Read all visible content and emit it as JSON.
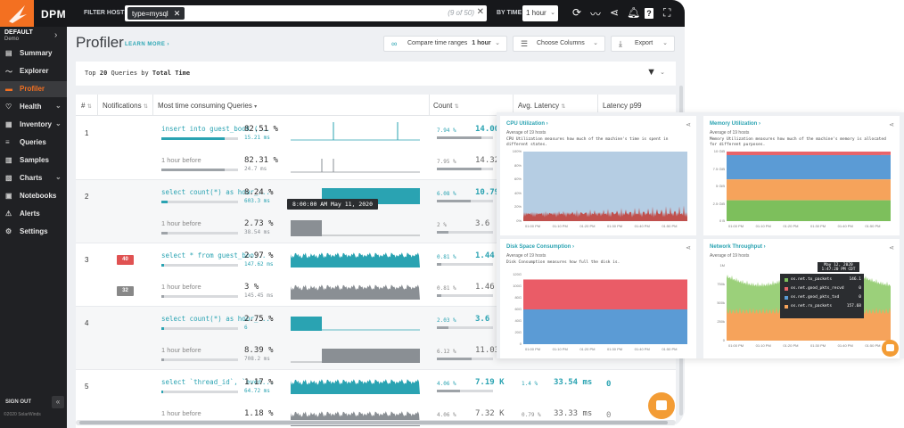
{
  "app": {
    "name": "DPM"
  },
  "topbar": {
    "filter_label": "FILTER HOSTS",
    "filter_chip": "type=mysql",
    "filter_count": "(9 of 50)",
    "by_time_label": "BY TIME",
    "time_value": "1 hour"
  },
  "sidebar": {
    "account": "DEFAULT",
    "account_sub": "Demo",
    "items": [
      {
        "label": "Summary",
        "icon": "summary-icon"
      },
      {
        "label": "Explorer",
        "icon": "explorer-icon"
      },
      {
        "label": "Profiler",
        "icon": "profiler-icon"
      },
      {
        "label": "Health",
        "icon": "health-icon"
      },
      {
        "label": "Inventory",
        "icon": "inventory-icon"
      },
      {
        "label": "Queries",
        "icon": "queries-icon"
      },
      {
        "label": "Samples",
        "icon": "samples-icon"
      },
      {
        "label": "Charts",
        "icon": "charts-icon"
      },
      {
        "label": "Notebooks",
        "icon": "notebooks-icon"
      },
      {
        "label": "Alerts",
        "icon": "alerts-icon"
      },
      {
        "label": "Settings",
        "icon": "settings-icon"
      }
    ],
    "sign_out": "SIGN OUT",
    "copyright": "©2020 SolarWinds"
  },
  "page": {
    "title": "Profiler",
    "learn_more": "LEARN MORE ›",
    "compare_label": "Compare time ranges",
    "compare_value": "1 hour",
    "choose_columns": "Choose Columns",
    "export": "Export",
    "toolbar_prefix": "Top",
    "toolbar_count": "20",
    "toolbar_mid": "Queries by",
    "toolbar_metric": "Total Time"
  },
  "columns": [
    "#",
    "Notifications",
    "Most time consuming Queries",
    "Count",
    "Avg. Latency",
    "Latency p99"
  ],
  "rows": [
    {
      "num": "1",
      "badge": "",
      "badge_before": "",
      "query": "insert into guest_book (...",
      "before": "1 hour before",
      "pct": "82.51 %",
      "time": "15.21 ms",
      "pct_before": "82.31 %",
      "time_before": "24.7 ms",
      "count_pct": "7.94 %",
      "count": "14.00",
      "count_pct_before": "7.95 %",
      "count_before": "14.32",
      "lat_pct": "",
      "lat": "",
      "lat_pct_before": "",
      "lat_before": "",
      "p99": "",
      "p99_before": "",
      "spark_kind": "spike",
      "bar": 0.82
    },
    {
      "num": "2",
      "badge": "",
      "badge_before": "",
      "query": "select count(*) as hour_...",
      "before": "1 hour before",
      "pct": "8.24 %",
      "time": "603.3 ms",
      "pct_before": "2.73 %",
      "time_before": "38.54 ms",
      "count_pct": "6.08 %",
      "count": "10.79",
      "count_pct_before": "2 %",
      "count_before": "3.6",
      "lat_pct": "",
      "lat": "",
      "lat_pct_before": "",
      "lat_before": "",
      "p99": "",
      "p99_before": "",
      "spark_kind": "block",
      "bar": 0.08
    },
    {
      "num": "3",
      "badge": "40",
      "badge_before": "32",
      "query": "select * from guest_boo...",
      "before": "1 hour before",
      "pct": "2.97 %",
      "time": "147.62 ms",
      "pct_before": "3 %",
      "time_before": "145.45 ms",
      "count_pct": "0.81 %",
      "count": "1.44",
      "count_pct_before": "0.81 %",
      "count_before": "1.46",
      "lat_pct": "",
      "lat": "",
      "lat_pct_before": "",
      "lat_before": "",
      "p99": "",
      "p99_before": "",
      "spark_kind": "dense",
      "bar": 0.03
    },
    {
      "num": "4",
      "badge": "",
      "badge_before": "",
      "query": "select count(*) as hour_...",
      "before": "1 hour before",
      "pct": "2.75 %",
      "time": "6",
      "pct_before": "8.39 %",
      "time_before": "708.2 ms",
      "count_pct": "2.03 %",
      "count": "3.6",
      "count_pct_before": "6.12 %",
      "count_before": "11.03",
      "lat_pct": "",
      "lat": "",
      "lat_pct_before": "",
      "lat_before": "",
      "p99": "",
      "p99_before": "",
      "spark_kind": "block-left",
      "bar": 0.03
    },
    {
      "num": "5",
      "badge": "",
      "badge_before": "",
      "query": "select `thread_id`, `even...",
      "before": "1 hour before",
      "pct": "1.17 %",
      "time": "64.72 ms",
      "pct_before": "1.18 %",
      "time_before": "",
      "count_pct": "4.06 %",
      "count": "7.19 K",
      "count_pct_before": "4.06 %",
      "count_before": "7.32 K",
      "lat_pct": "1.4 %",
      "lat": "33.54 ms",
      "lat_pct_before": "0.79 %",
      "lat_before": "33.33 ms",
      "p99": "0",
      "p99_before": "0",
      "spark_kind": "dense",
      "bar": 0.01
    }
  ],
  "tooltip": "8:00:00 AM May 11, 2020",
  "cards": [
    {
      "title": "CPU Utilization ›",
      "sub": "Average of 19 hosts",
      "desc": "CPU Utilization measures how much of the machine's time is spent in different states.",
      "yticks": [
        "100%",
        "80%",
        "60%",
        "40%",
        "20%",
        "0%"
      ],
      "xticks": [
        "01:00 PM",
        "01:10 PM",
        "01:20 PM",
        "01:30 PM",
        "01:40 PM",
        "01:50 PM"
      ],
      "colors": {
        "main": "#b5cde3",
        "base": "#c0504d"
      }
    },
    {
      "title": "Memory Utilization ›",
      "sub": "Average of 19 hosts",
      "desc": "Memory Utilization measures how much of the machine's memory is allocated for different purposes.",
      "yticks": [
        "10 GiB",
        "7.5 GiB",
        "5 GiB",
        "2.5 GiB",
        "0 B"
      ],
      "xticks": [
        "01:00 PM",
        "01:10 PM",
        "01:20 PM",
        "01:30 PM",
        "01:40 PM",
        "01:50 PM"
      ],
      "colors": {
        "red": "#e8646a",
        "blue": "#5b9bd5",
        "orange": "#f6a35b",
        "green": "#7dbf5c"
      }
    },
    {
      "title": "Disk Space Consumption ›",
      "sub": "Average of 19 hosts",
      "desc": "Disk Consumption measures how full the disk is.",
      "yticks": [
        "120G",
        "100G",
        "80G",
        "60G",
        "40G",
        "20G",
        "0"
      ],
      "xticks": [
        "01:00 PM",
        "01:10 PM",
        "01:20 PM",
        "01:30 PM",
        "01:40 PM",
        "01:50 PM"
      ],
      "colors": {
        "red": "#ea5c67",
        "blue": "#5b9bd5"
      }
    },
    {
      "title": "Network Throughput ›",
      "sub": "Average of 19 hosts",
      "desc": "",
      "yticks": [
        "1M",
        "750k",
        "500k",
        "250k",
        "0"
      ],
      "xticks": [
        "01:00 PM",
        "01:10 PM",
        "01:20 PM",
        "01:30 PM",
        "01:40 PM",
        "01:50 PM"
      ],
      "colors": {
        "green": "#9bd07a",
        "orange": "#f6a35b"
      }
    }
  ],
  "net_tooltip": {
    "title": "May 12, 2020 1:47:20 PM CDT",
    "rows": [
      {
        "label": "os.net.tx_packets",
        "value": "146.1",
        "color": "#7dbf5c"
      },
      {
        "label": "os.net.good_pkts_recvd",
        "value": "0",
        "color": "#e8646a"
      },
      {
        "label": "os.net.good_pkts_txd",
        "value": "0",
        "color": "#5b9bd5"
      },
      {
        "label": "os.net.rx_packets",
        "value": "157.68",
        "color": "#f6a35b"
      }
    ]
  }
}
